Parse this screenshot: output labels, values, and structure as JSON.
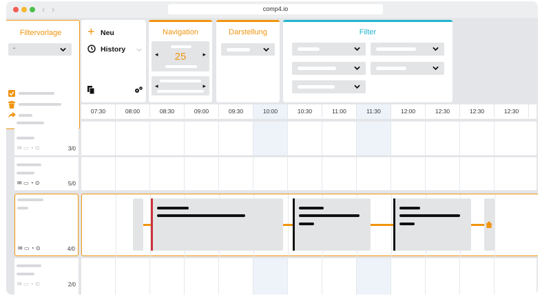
{
  "browser": {
    "url": "comp4.io",
    "dots": [
      "#f25c54",
      "#f5b82e",
      "#4cbf4a"
    ],
    "back": "‹",
    "forward": "›"
  },
  "filtervorlage": {
    "title": "Filtervorlage",
    "select_value": "-"
  },
  "actions": {
    "new_label": "Neu",
    "new_icon": "+",
    "history_label": "History"
  },
  "navigation": {
    "title": "Navigation",
    "value": "25",
    "prev": "◂",
    "next": "▸"
  },
  "darstellung": {
    "title": "Darstellung"
  },
  "filter": {
    "title": "Filter"
  },
  "timeline": {
    "times": [
      "07:30",
      "08:00",
      "08:30",
      "09:00",
      "09:30",
      "10:00",
      "10:30",
      "11:00",
      "11:30",
      "12:00",
      "12:30",
      "12:30",
      "12:30"
    ]
  },
  "rows": [
    {
      "count": "3/0"
    },
    {
      "count": "5/0"
    },
    {
      "count": "4/0"
    },
    {
      "count": "2/0"
    }
  ],
  "colors": {
    "accent": "#f0940f",
    "filter_accent": "#1fb5cc",
    "stripe_red": "#c8343a",
    "stripe_black": "#111111"
  },
  "icons": {
    "checkbox": "checkbox-icon",
    "trash": "trash-icon",
    "share": "share-icon",
    "copy": "copy-icon",
    "settings": "gears-icon",
    "clock": "clock-icon",
    "mail": "mail-icon",
    "chat": "chat-icon",
    "bell": "bell-icon",
    "pin": "pin-icon",
    "home": "home-icon"
  }
}
